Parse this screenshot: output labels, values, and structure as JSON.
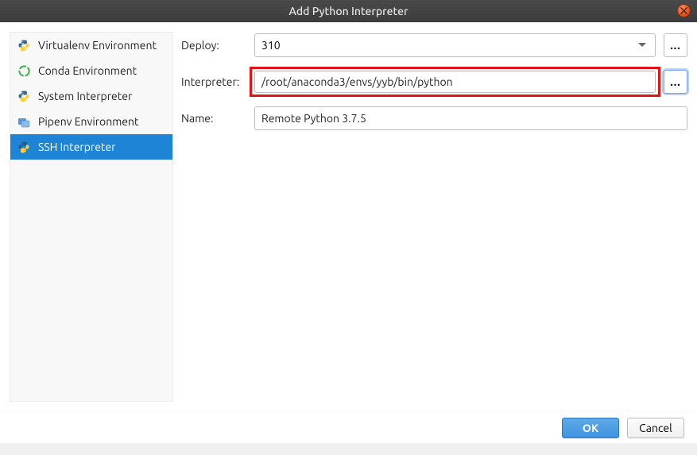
{
  "title": "Add Python Interpreter",
  "sidebar": {
    "items": [
      {
        "label": "Virtualenv Environment",
        "icon": "python-icon",
        "selected": false
      },
      {
        "label": "Conda Environment",
        "icon": "conda-icon",
        "selected": false
      },
      {
        "label": "System Interpreter",
        "icon": "python-icon",
        "selected": false
      },
      {
        "label": "Pipenv Environment",
        "icon": "pipenv-icon",
        "selected": false
      },
      {
        "label": "SSH Interpreter",
        "icon": "python-ssh-icon",
        "selected": true
      }
    ]
  },
  "form": {
    "deploy": {
      "label": "Deploy:",
      "value": "310"
    },
    "interpreter": {
      "label": "Interpreter:",
      "value": "/root/anaconda3/envs/yyb/bin/python"
    },
    "name": {
      "label": "Name:",
      "value": "Remote Python 3.7.5"
    }
  },
  "browse_label": "...",
  "buttons": {
    "ok": "OK",
    "cancel": "Cancel"
  }
}
